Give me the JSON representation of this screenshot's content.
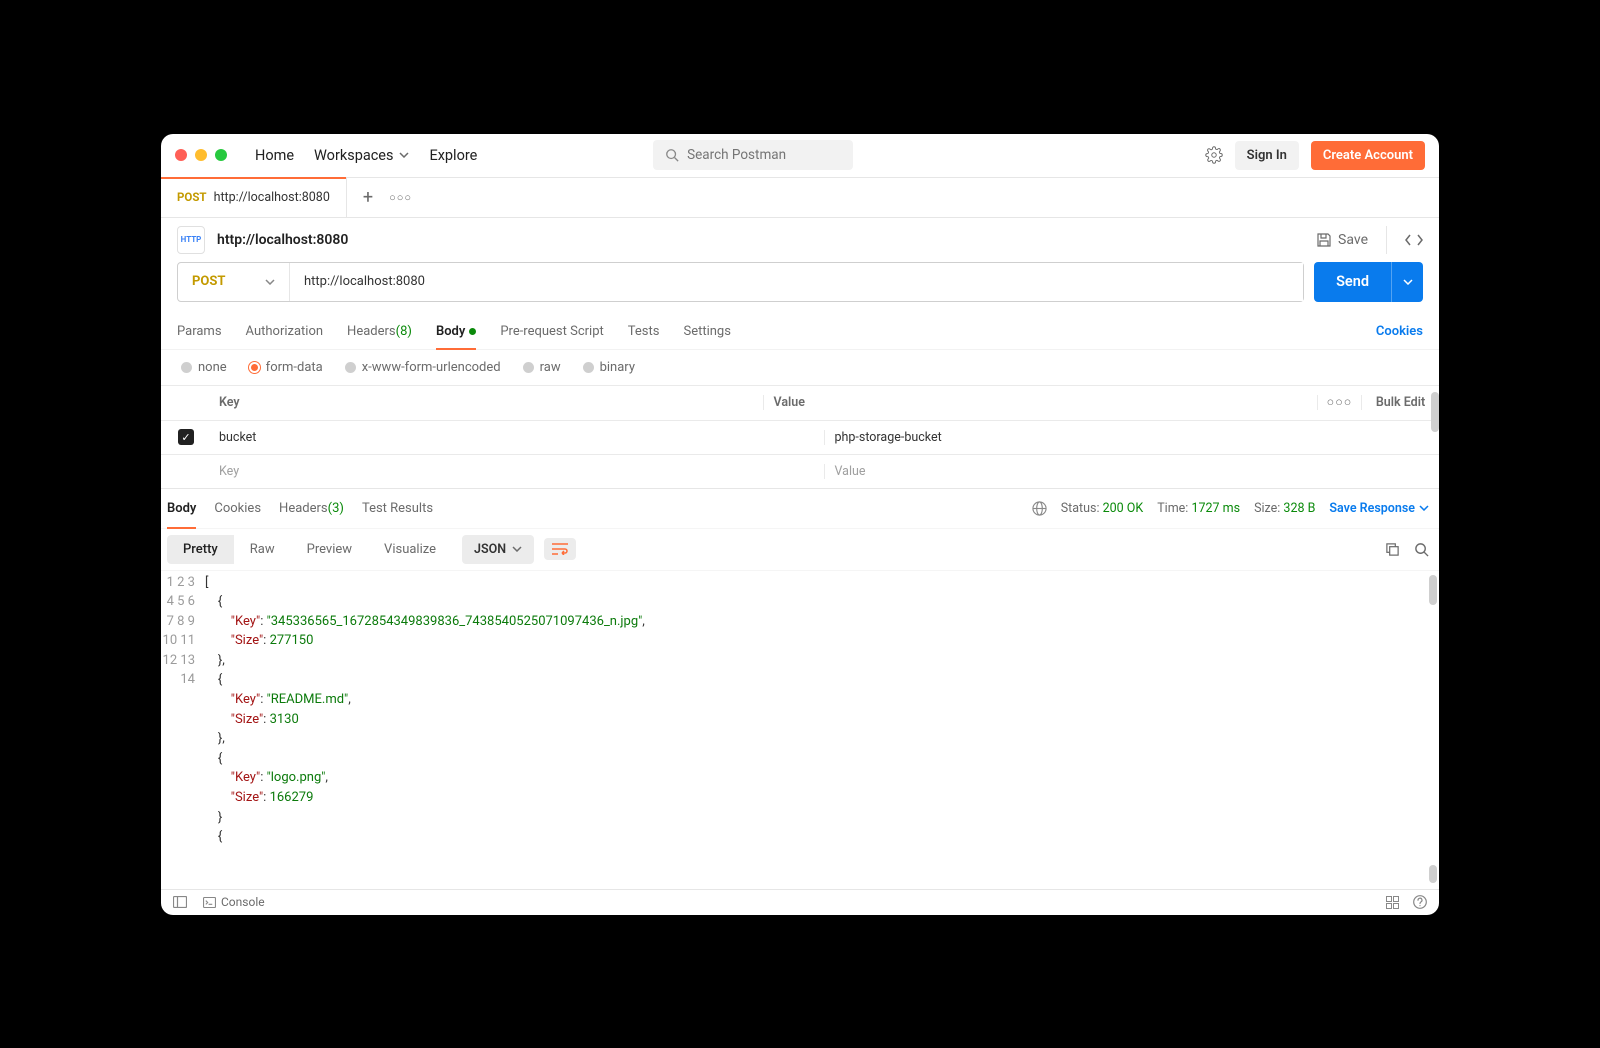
{
  "header": {
    "navHome": "Home",
    "navWorkspaces": "Workspaces",
    "navExplore": "Explore",
    "searchPlaceholder": "Search Postman",
    "signIn": "Sign In",
    "createAccount": "Create Account"
  },
  "tabStrip": {
    "method": "POST",
    "url": "http://localhost:8080"
  },
  "title": {
    "badge": "HTTP",
    "text": "http://localhost:8080",
    "save": "Save"
  },
  "request": {
    "method": "POST",
    "url": "http://localhost:8080",
    "send": "Send"
  },
  "reqTabs": {
    "params": "Params",
    "authorization": "Authorization",
    "headers": "Headers",
    "headersCount": "(8)",
    "body": "Body",
    "prereq": "Pre-request Script",
    "tests": "Tests",
    "settings": "Settings",
    "cookies": "Cookies"
  },
  "bodyTypes": {
    "none": "none",
    "formdata": "form-data",
    "urlencoded": "x-www-form-urlencoded",
    "raw": "raw",
    "binary": "binary"
  },
  "formTable": {
    "headerKey": "Key",
    "headerValue": "Value",
    "bulkEdit": "Bulk Edit",
    "rowKey": "bucket",
    "rowValue": "php-storage-bucket",
    "placeholderKey": "Key",
    "placeholderValue": "Value"
  },
  "response": {
    "tabBody": "Body",
    "tabCookies": "Cookies",
    "tabHeaders": "Headers",
    "tabHeadersCount": "(3)",
    "tabTestResults": "Test Results",
    "statusLabel": "Status:",
    "statusValue": "200 OK",
    "timeLabel": "Time:",
    "timeValue": "1727 ms",
    "sizeLabel": "Size:",
    "sizeValue": "328 B",
    "saveResponse": "Save Response"
  },
  "viewOptions": {
    "pretty": "Pretty",
    "raw": "Raw",
    "preview": "Preview",
    "visualize": "Visualize",
    "format": "JSON"
  },
  "responseBody": [
    {
      "Key": "345336565_1672854349839836_7438540525071097436_n.jpg",
      "Size": 277150
    },
    {
      "Key": "README.md",
      "Size": 3130
    },
    {
      "Key": "logo.png",
      "Size": 166279
    }
  ],
  "footer": {
    "console": "Console"
  }
}
